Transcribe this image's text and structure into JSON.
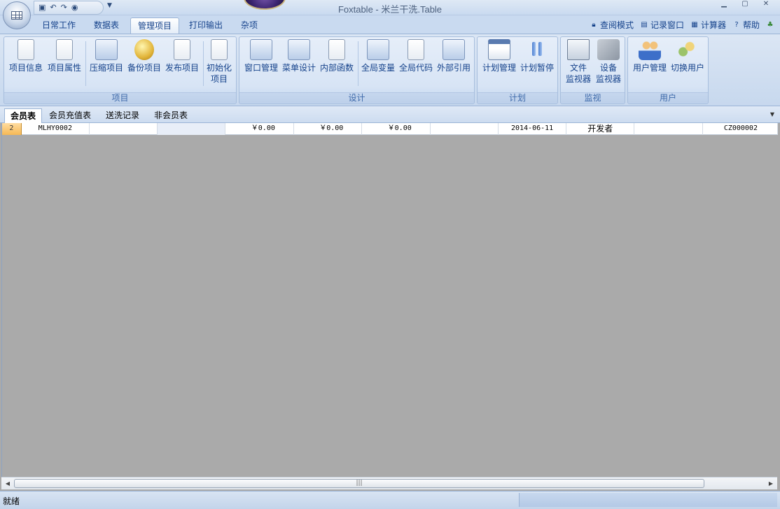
{
  "window": {
    "title": "Foxtable - 米兰干洗.Table",
    "qat_icons": [
      "save-icon",
      "undo-icon",
      "redo-icon",
      "help-icon"
    ],
    "controls": [
      "minimize-icon",
      "maximize-icon",
      "close-icon"
    ]
  },
  "ribbon": {
    "tabs": [
      "日常工作",
      "数据表",
      "管理项目",
      "打印输出",
      "杂项"
    ],
    "active_tab": "管理项目",
    "right_tools": [
      {
        "label": "查阅模式",
        "icon": "lock-icon"
      },
      {
        "label": "记录窗口",
        "icon": "window-icon"
      },
      {
        "label": "计算器",
        "icon": "calculator-icon"
      },
      {
        "label": "帮助",
        "icon": "help-icon"
      }
    ],
    "groups": [
      {
        "label": "项目",
        "buttons": [
          "项目信息",
          "项目属性",
          "压缩项目",
          "备份项目",
          "发布项目",
          "初始化项目"
        ]
      },
      {
        "label": "设计",
        "buttons": [
          "窗口管理",
          "菜单设计",
          "内部函数",
          "全局变量",
          "全局代码",
          "外部引用"
        ]
      },
      {
        "label": "计划",
        "buttons": [
          "计划管理",
          "计划暂停"
        ]
      },
      {
        "label": "监视",
        "buttons": [
          "文件监视器",
          "设备监视器"
        ]
      },
      {
        "label": "用户",
        "buttons": [
          "用户管理",
          "切换用户"
        ]
      }
    ]
  },
  "ribbon_buttons": {
    "init_line1": "初始化",
    "init_line2": "项目",
    "file_mon_line1": "文件",
    "file_mon_line2": "监视器",
    "dev_mon_line1": "设备",
    "dev_mon_line2": "监视器"
  },
  "sheet_tabs": [
    "会员表",
    "会员充值表",
    "送洗记录",
    "非会员表"
  ],
  "active_sheet": "会员表",
  "table": {
    "rows": [
      {
        "row_number": "2",
        "member_id": "MLHY0002",
        "col3": "",
        "col4": "",
        "amount1": "￥0.00",
        "amount2": "￥0.00",
        "amount3": "￥0.00",
        "col8": "",
        "date": "2014-06-11",
        "operator": "开发者",
        "col11": "",
        "code": "CZ000002"
      }
    ]
  },
  "status": {
    "text": "就绪"
  }
}
